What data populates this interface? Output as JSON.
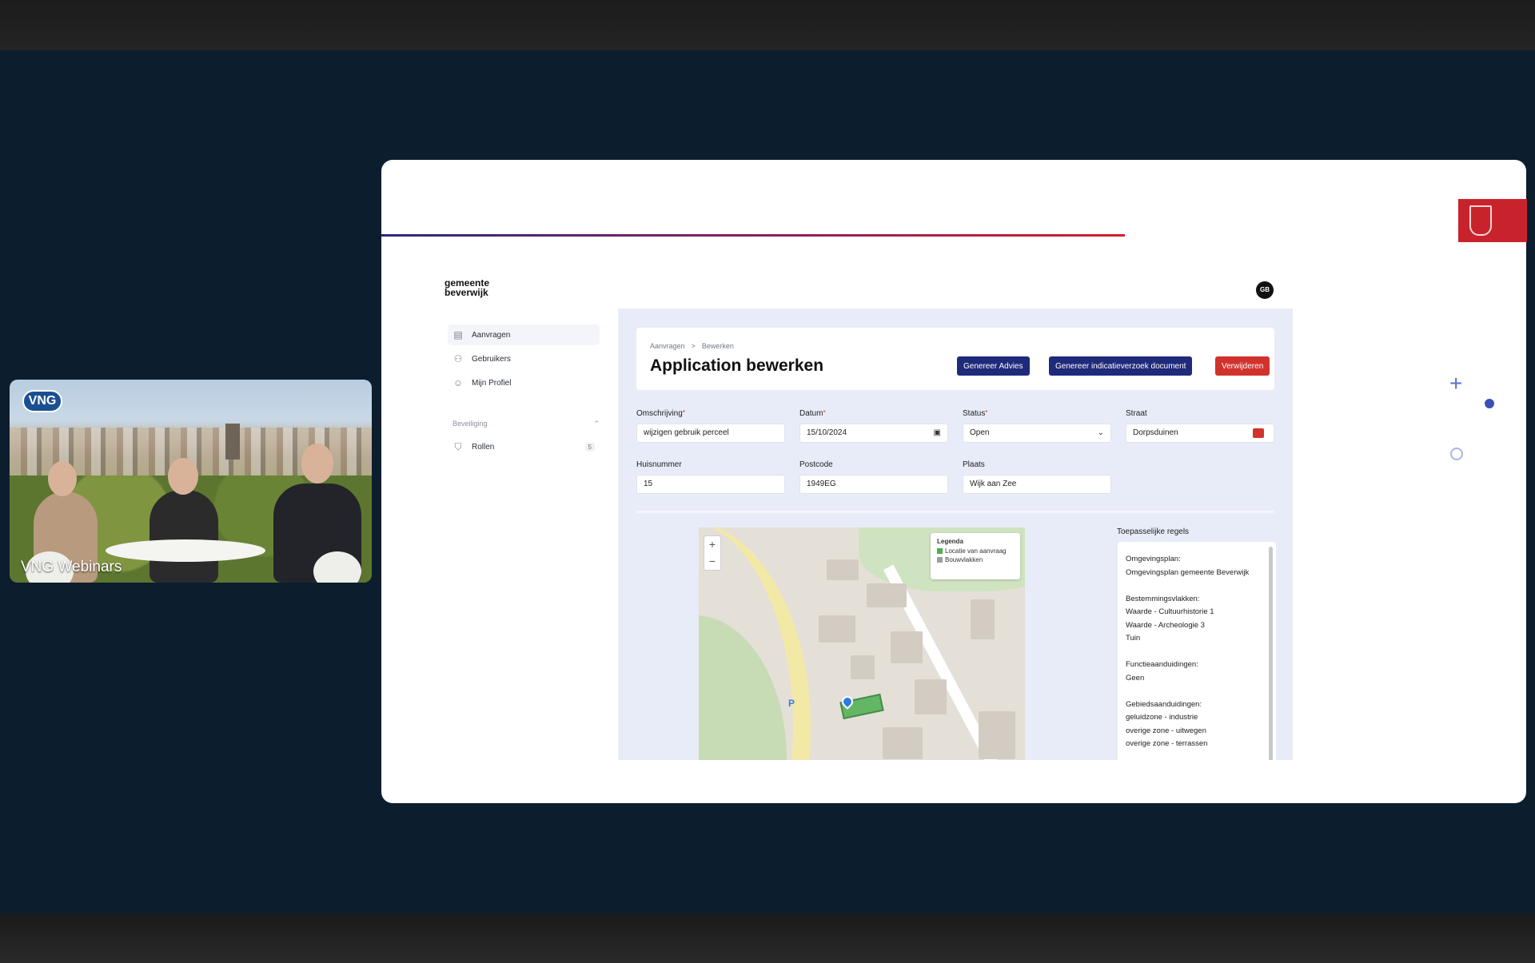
{
  "video": {
    "logo": "VNG",
    "caption": "VNG Webinars"
  },
  "app": {
    "brand_line1": "gemeente",
    "brand_line2": "beverwijk",
    "avatar": "GB",
    "nav": [
      {
        "label": "Aanvragen",
        "icon": "document-stack-icon",
        "active": true
      },
      {
        "label": "Gebruikers",
        "icon": "users-icon",
        "active": false
      },
      {
        "label": "Mijn Profiel",
        "icon": "user-icon",
        "active": false
      }
    ],
    "nav_section": "Beveiliging",
    "nav_roles": {
      "label": "Rollen",
      "count": "5",
      "icon": "shield-icon"
    },
    "breadcrumb": [
      "Aanvragen",
      "Bewerken"
    ],
    "breadcrumb_sep": ">",
    "title": "Application bewerken",
    "buttons": {
      "advice": "Genereer Advies",
      "indication": "Genereer indicatieverzoek document",
      "delete": "Verwijderen"
    },
    "form": {
      "omschrijving": {
        "label": "Omschrijving",
        "value": "wijzigen gebruik perceel"
      },
      "datum": {
        "label": "Datum",
        "value": "15/10/2024"
      },
      "status": {
        "label": "Status",
        "value": "Open"
      },
      "straat": {
        "label": "Straat",
        "value": "Dorpsduinen"
      },
      "huisnummer": {
        "label": "Huisnummer",
        "value": "15"
      },
      "postcode": {
        "label": "Postcode",
        "value": "1949EG"
      },
      "plaats": {
        "label": "Plaats",
        "value": "Wijk aan Zee"
      },
      "required_mark": "*"
    },
    "map": {
      "legend_title": "Legenda",
      "legend_items": [
        {
          "label": "Locatie van aanvraag",
          "color": "#4caf50"
        },
        {
          "label": "Bouwvlakken",
          "color": "#9e9e9e"
        }
      ],
      "zoom_in": "+",
      "zoom_out": "−",
      "parking_label": "P"
    },
    "rules": {
      "title": "Toepasselijke regels",
      "lines": [
        "Omgevingsplan:",
        "Omgevingsplan gemeente Beverwijk",
        "",
        "Bestemmingsvlakken:",
        "Waarde - Cultuurhistorie 1",
        "Waarde - Archeologie 3",
        "Tuin",
        "",
        "Functieaanduidingen:",
        "Geen",
        "",
        "Gebiedsaanduidingen:",
        "geluidzone - industrie",
        "overige zone - uitwegen",
        "overige zone - terrassen"
      ]
    }
  },
  "colors": {
    "primary_button": "#1f2a7a",
    "danger_button": "#d2322d",
    "page_background": "#0c1e2d"
  }
}
